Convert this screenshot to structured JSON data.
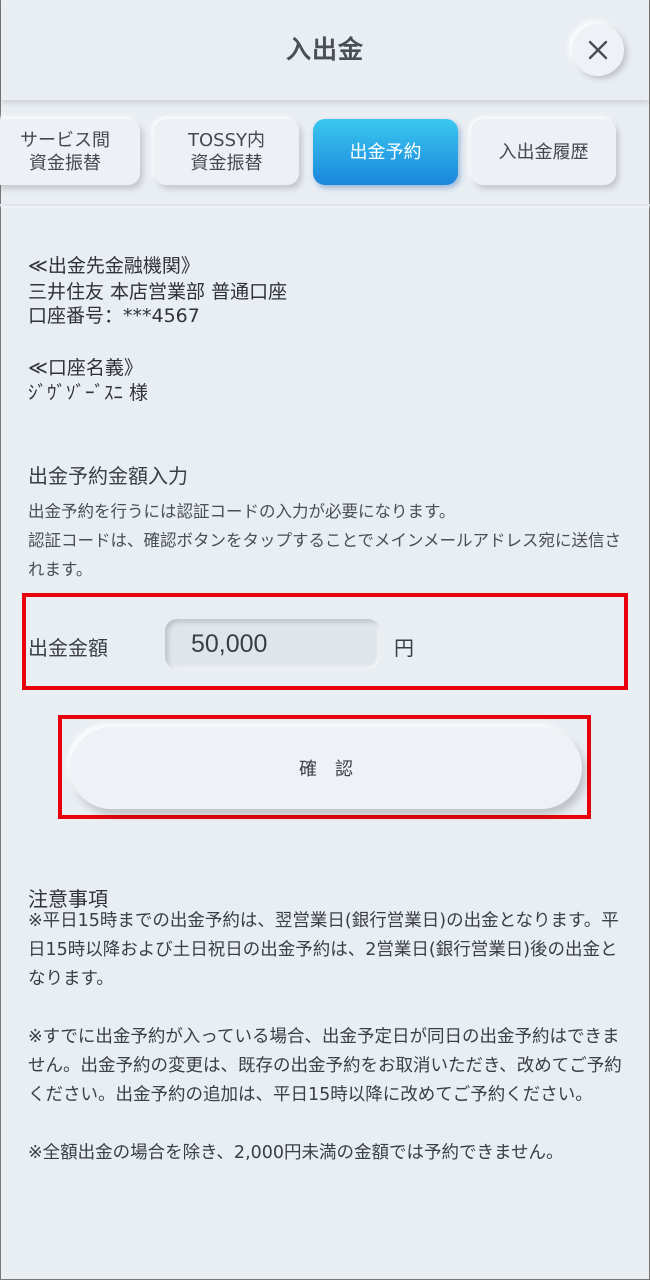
{
  "header": {
    "title": "入出金",
    "close_icon": "close-icon"
  },
  "tabs": [
    {
      "label": "サービス間\n資金振替",
      "active": false
    },
    {
      "label": "TOSSY内\n資金振替",
      "active": false
    },
    {
      "label": "出金予約",
      "active": true
    },
    {
      "label": "入出金履歴",
      "active": false
    }
  ],
  "bank": {
    "heading": "≪出金先金融機関》",
    "branch": "三井住友 本店営業部 普通口座",
    "account_number": "口座番号：***4567"
  },
  "holder": {
    "heading": "≪口座名義》",
    "name": "ｼﾞｳﾞｿﾞｰﾞｽﾆ 様"
  },
  "form": {
    "section_title": "出金予約金額入力",
    "description": "出金予約を行うには認証コードの入力が必要になります。\n認証コードは、確認ボタンをタップすることでメインメールアドレス宛に送信されます。",
    "amount_label": "出金金額",
    "amount_value": "50,000",
    "currency": "円",
    "confirm_label": "確　認"
  },
  "notes": {
    "title": "注意事項",
    "items": [
      "※平日15時までの出金予約は、翌営業日(銀行営業日)の出金となります。平日15時以降および土日祝日の出金予約は、2営業日(銀行営業日)後の出金となります。",
      "※すでに出金予約が入っている場合、出金予定日が同日の出金予約はできません。出金予約の変更は、既存の出金予約をお取消いただき、改めてご予約ください。出金予約の追加は、平日15時以降に改めてご予約ください。",
      "※全額出金の場合を除き、2,000円未満の金額では予約できません。"
    ]
  },
  "colors": {
    "background": "#e9eef3",
    "accent_start": "#3ac8ef",
    "accent_end": "#1b86dc",
    "highlight_red": "#e8000b"
  }
}
